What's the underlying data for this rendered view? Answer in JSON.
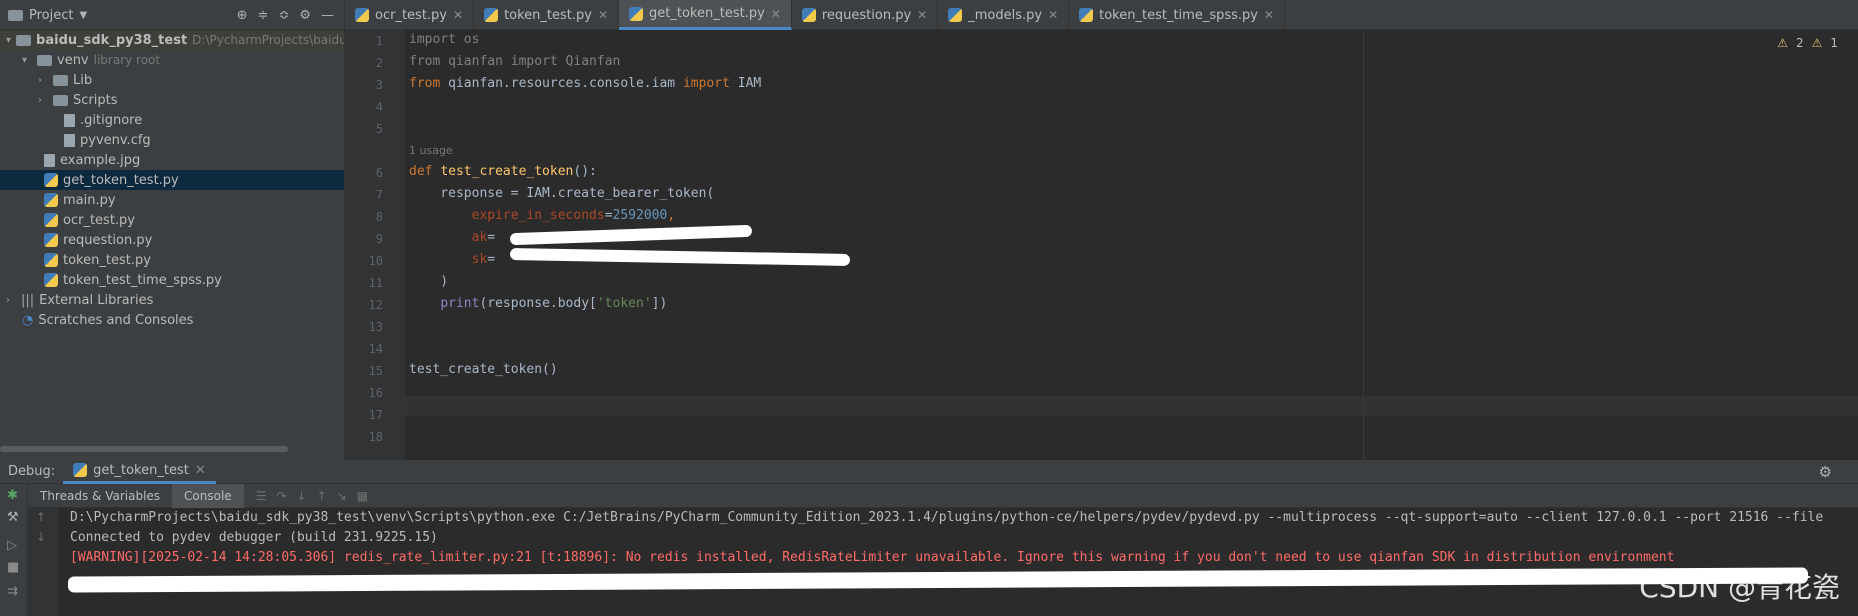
{
  "project_panel": {
    "title": "Project",
    "tree": [
      {
        "label": "baidu_sdk_py38_test",
        "sub": "D:\\PycharmProjects\\baidu_sdk"
      },
      {
        "label": "venv",
        "sub": "library root"
      },
      {
        "label": "Lib"
      },
      {
        "label": "Scripts"
      },
      {
        "label": ".gitignore"
      },
      {
        "label": "pyvenv.cfg"
      },
      {
        "label": "example.jpg"
      },
      {
        "label": "get_token_test.py"
      },
      {
        "label": "main.py"
      },
      {
        "label": "ocr_test.py"
      },
      {
        "label": "requestion.py"
      },
      {
        "label": "token_test.py"
      },
      {
        "label": "token_test_time_spss.py"
      },
      {
        "label": "External Libraries"
      },
      {
        "label": "Scratches and Consoles"
      }
    ]
  },
  "editor_tabs": [
    {
      "label": "ocr_test.py"
    },
    {
      "label": "token_test.py"
    },
    {
      "label": "get_token_test.py"
    },
    {
      "label": "requestion.py"
    },
    {
      "label": "_models.py"
    },
    {
      "label": "token_test_time_spss.py"
    }
  ],
  "inspections": {
    "warnings": "2",
    "weak_warnings": "1"
  },
  "editor": {
    "line_numbers": [
      "1",
      "2",
      "3",
      "4",
      "5",
      "6",
      "7",
      "8",
      "9",
      "10",
      "11",
      "12",
      "13",
      "14",
      "15",
      "16",
      "17",
      "18"
    ],
    "usage_hint": "1 usage",
    "lines": {
      "l1": [
        "import",
        " os"
      ],
      "l2": [
        "from",
        " qianfan ",
        "import",
        " Qianfan"
      ],
      "l3": [
        "from",
        " qianfan.resources.console.iam ",
        "import",
        " IAM"
      ],
      "l6": [
        "def",
        " ",
        "test_create_token",
        "():"
      ],
      "l7": "    response = IAM.create_bearer_token(",
      "l8": [
        "        ",
        "expire_in_seconds",
        "=",
        "2592000",
        ","
      ],
      "l9": [
        "        ",
        "ak",
        "="
      ],
      "l10": [
        "        ",
        "sk",
        "="
      ],
      "l11": "    )",
      "l12": [
        "    ",
        "print",
        "(response.body[",
        "'token'",
        "])"
      ],
      "l15": "test_create_token()"
    }
  },
  "debug": {
    "title": "Debug:",
    "run_config": "get_token_test",
    "tabs": [
      "Threads & Variables",
      "Console"
    ],
    "console": [
      "D:\\PycharmProjects\\baidu_sdk_py38_test\\venv\\Scripts\\python.exe C:/JetBrains/PyCharm_Community_Edition_2023.1.4/plugins/python-ce/helpers/pydev/pydevd.py --multiprocess --qt-support=auto --client 127.0.0.1 --port 21516 --file",
      "Connected to pydev debugger (build 231.9225.15)",
      "[WARNING][2025-02-14 14:28:05.306] redis_rate_limiter.py:21 [t:18896]: No redis installed, RedisRateLimiter unavailable. Ignore this warning if you don't need to use qianfan SDK in distribution environment"
    ]
  },
  "watermark": "CSDN @青花瓷",
  "colors": {
    "keyword": "#cc7832",
    "function": "#ffc66d",
    "param": "#aa4926",
    "number": "#6897bb",
    "string": "#6a8759",
    "warning_text": "#ff6b68",
    "accent": "#4a88c7"
  },
  "icons": [
    "gear-icon",
    "folder-icon",
    "python-file-icon",
    "debug-bug-icon",
    "warning-icon"
  ]
}
